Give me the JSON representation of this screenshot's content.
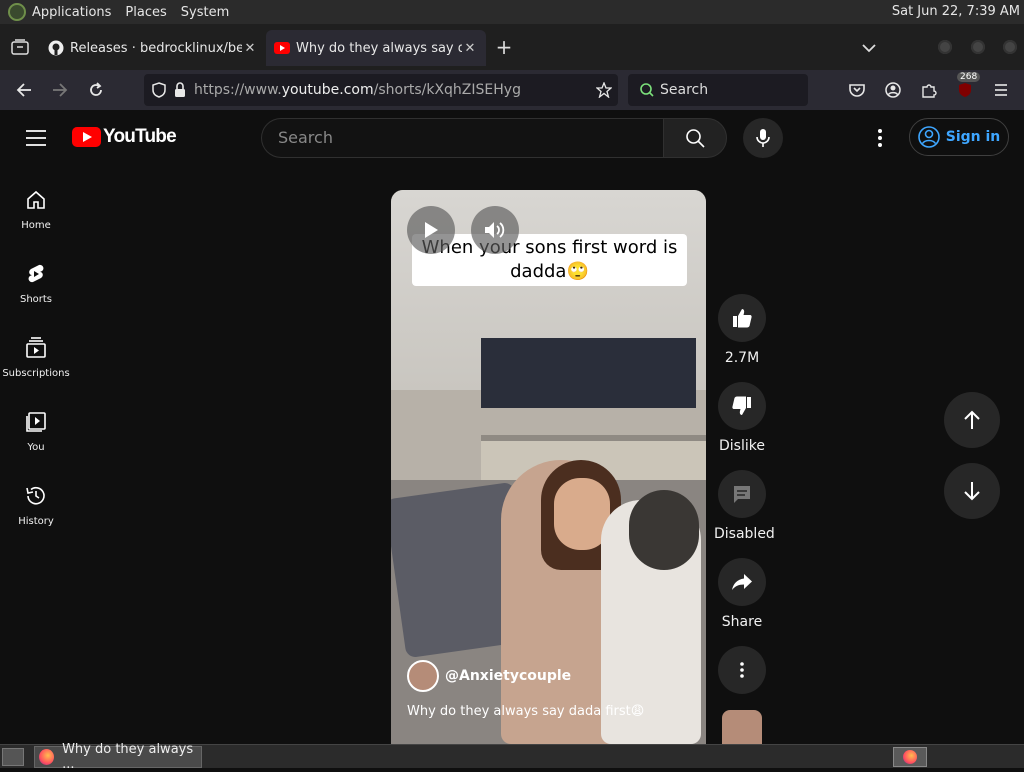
{
  "system_bar": {
    "menus": [
      "Applications",
      "Places",
      "System"
    ],
    "clock": "Sat Jun 22,  7:39 AM"
  },
  "browser": {
    "tabs": [
      {
        "title": "Releases · bedrocklinux/bed",
        "icon": "github-icon"
      },
      {
        "title": "Why do they always say dad",
        "icon": "youtube-icon"
      }
    ],
    "url_prefix": "https://www.",
    "url_domain": "youtube.com",
    "url_path": "/shorts/kXqhZISEHyg",
    "search_placeholder": "Search",
    "extension_badge": "268"
  },
  "youtube": {
    "logo_text": "YouTube",
    "search_placeholder": "Search",
    "sign_in": "Sign in",
    "sidebar": [
      {
        "label": "Home",
        "icon": "home-icon"
      },
      {
        "label": "Shorts",
        "icon": "shorts-icon"
      },
      {
        "label": "Subscriptions",
        "icon": "subscriptions-icon"
      },
      {
        "label": "You",
        "icon": "you-icon"
      },
      {
        "label": "History",
        "icon": "history-icon"
      }
    ],
    "short": {
      "caption": "When your sons first word is dadda🙄",
      "channel": "@Anxietycouple",
      "title": "Why do they always say dada first😩",
      "likes": "2.7M",
      "dislike_label": "Dislike",
      "comments_label": "Disabled",
      "share_label": "Share"
    }
  },
  "taskbar": {
    "window_title": "Why do they always ..."
  }
}
